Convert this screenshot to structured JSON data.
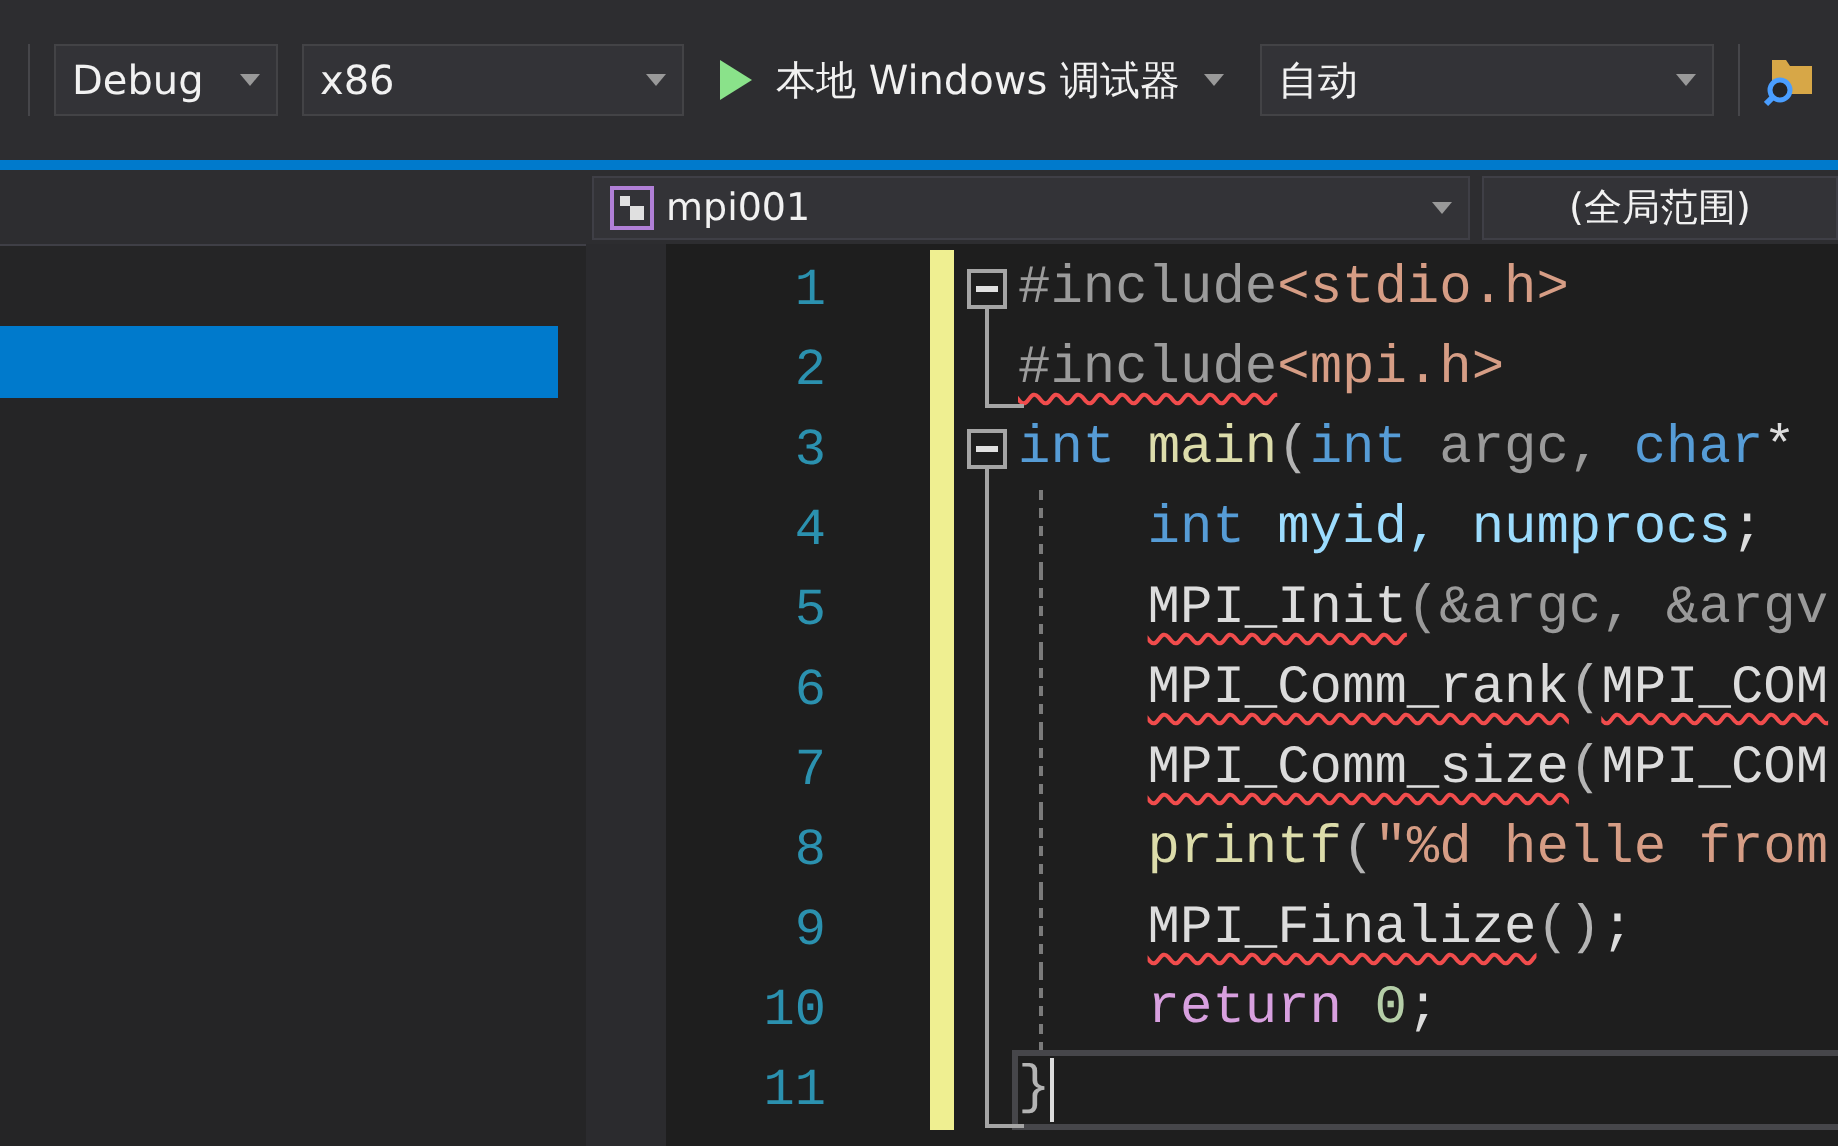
{
  "toolbar": {
    "configuration": {
      "value": "Debug"
    },
    "platform": {
      "value": "x86"
    },
    "debugger": {
      "label": "本地 Windows 调试器"
    },
    "mode": {
      "value": "自动"
    }
  },
  "solution_panel": {
    "rows": [
      {
        "selected": true
      }
    ]
  },
  "navigation": {
    "project": {
      "value": "mpi001"
    },
    "scope": {
      "value": "(全局范围)"
    }
  },
  "editor": {
    "lines": [
      {
        "number": "1",
        "modified": true,
        "kind": "fold_start",
        "indented": false,
        "current": false,
        "tokens": [
          {
            "text": "#include",
            "kind": "preproc",
            "squiggle": false
          },
          {
            "text": "<stdio.h>",
            "kind": "string",
            "squiggle": false
          }
        ]
      },
      {
        "number": "2",
        "modified": true,
        "kind": "fold_end",
        "indented": false,
        "current": false,
        "tokens": [
          {
            "text": "#include",
            "kind": "preproc",
            "squiggle": true
          },
          {
            "text": "<mpi.h>",
            "kind": "string",
            "squiggle": false
          }
        ]
      },
      {
        "number": "3",
        "modified": true,
        "kind": "fold_start",
        "indented": false,
        "current": false,
        "tokens": [
          {
            "text": "int ",
            "kind": "keyword",
            "squiggle": false
          },
          {
            "text": "main",
            "kind": "func",
            "squiggle": false
          },
          {
            "text": "(",
            "kind": "punct",
            "squiggle": false
          },
          {
            "text": "int",
            "kind": "keyword",
            "squiggle": false
          },
          {
            "text": " argc, ",
            "kind": "param",
            "squiggle": false
          },
          {
            "text": "char",
            "kind": "keyword",
            "squiggle": false
          },
          {
            "text": "*",
            "kind": "plain",
            "squiggle": false
          }
        ]
      },
      {
        "number": "4",
        "modified": true,
        "kind": "body",
        "indented": true,
        "current": false,
        "tokens": [
          {
            "text": "int",
            "kind": "keyword",
            "squiggle": false
          },
          {
            "text": " myid, numprocs",
            "kind": "local",
            "squiggle": false
          },
          {
            "text": ";",
            "kind": "plain",
            "squiggle": false
          }
        ]
      },
      {
        "number": "5",
        "modified": true,
        "kind": "body",
        "indented": true,
        "current": false,
        "tokens": [
          {
            "text": "MPI_Init",
            "kind": "plain",
            "squiggle": true
          },
          {
            "text": "(&argc, &argv",
            "kind": "param",
            "squiggle": false
          }
        ]
      },
      {
        "number": "6",
        "modified": true,
        "kind": "body",
        "indented": true,
        "current": false,
        "tokens": [
          {
            "text": "MPI_Comm_rank",
            "kind": "plain",
            "squiggle": true
          },
          {
            "text": "(",
            "kind": "punct",
            "squiggle": false
          },
          {
            "text": "MPI_COM",
            "kind": "plain",
            "squiggle": true
          }
        ]
      },
      {
        "number": "7",
        "modified": true,
        "kind": "body",
        "indented": true,
        "current": false,
        "tokens": [
          {
            "text": "MPI_Comm_size",
            "kind": "plain",
            "squiggle": true
          },
          {
            "text": "(",
            "kind": "punct",
            "squiggle": false
          },
          {
            "text": "MPI_COM",
            "kind": "plain",
            "squiggle": false
          }
        ]
      },
      {
        "number": "8",
        "modified": true,
        "kind": "body",
        "indented": true,
        "current": false,
        "tokens": [
          {
            "text": "printf",
            "kind": "func",
            "squiggle": false
          },
          {
            "text": "(",
            "kind": "punct",
            "squiggle": false
          },
          {
            "text": "\"%d helle from",
            "kind": "string",
            "squiggle": false
          }
        ]
      },
      {
        "number": "9",
        "modified": true,
        "kind": "body",
        "indented": true,
        "current": false,
        "tokens": [
          {
            "text": "MPI_Finalize",
            "kind": "plain",
            "squiggle": true
          },
          {
            "text": "()",
            "kind": "punct",
            "squiggle": false
          },
          {
            "text": ";",
            "kind": "plain",
            "squiggle": false
          }
        ]
      },
      {
        "number": "10",
        "modified": true,
        "kind": "body",
        "indented": true,
        "current": false,
        "tokens": [
          {
            "text": "return ",
            "kind": "control",
            "squiggle": false
          },
          {
            "text": "0",
            "kind": "number",
            "squiggle": false
          },
          {
            "text": ";",
            "kind": "plain",
            "squiggle": false
          }
        ]
      },
      {
        "number": "11",
        "modified": true,
        "kind": "fold_end",
        "indented": false,
        "current": true,
        "tokens": [
          {
            "text": "}",
            "kind": "punct",
            "squiggle": false
          }
        ]
      }
    ]
  }
}
